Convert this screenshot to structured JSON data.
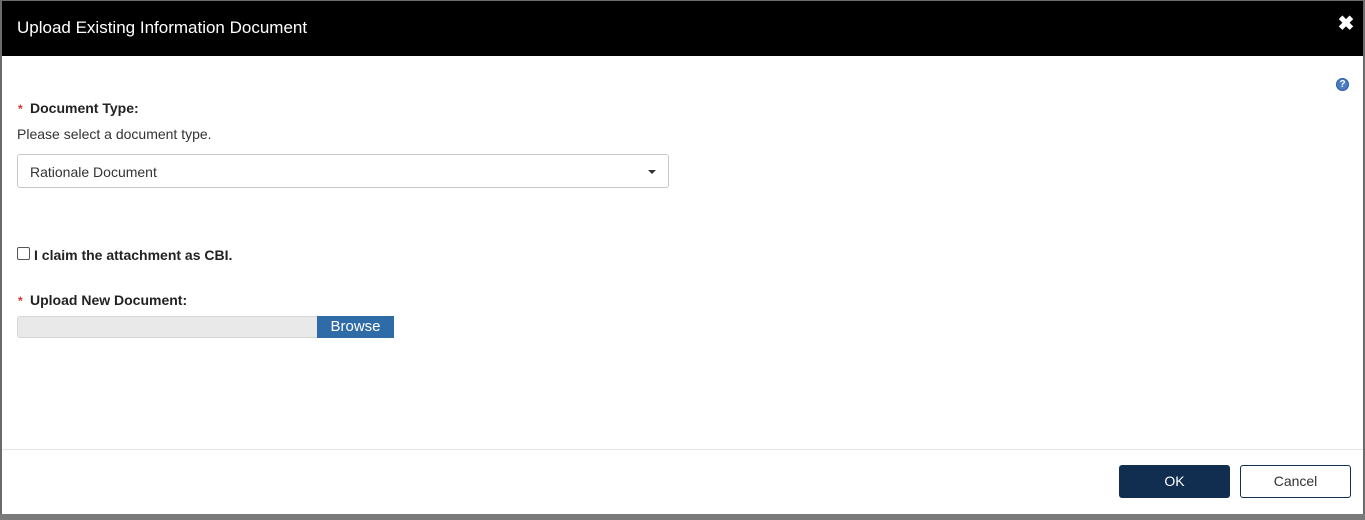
{
  "dialog": {
    "title": "Upload Existing Information Document",
    "close_icon": "close-icon",
    "help_icon": "help-icon"
  },
  "document_type": {
    "required_marker": "*",
    "label": "Document Type:",
    "hint": "Please select a document type.",
    "selected": "Rationale Document"
  },
  "cbi": {
    "checked": false,
    "label": "I claim the attachment as CBI."
  },
  "upload": {
    "required_marker": "*",
    "label": "Upload New Document:",
    "browse_label": "Browse"
  },
  "footer": {
    "ok_label": "OK",
    "cancel_label": "Cancel"
  },
  "colors": {
    "header_bg": "#000000",
    "primary_button": "#112e51",
    "browse_button": "#2f6ba7",
    "required_star": "#d9302c"
  }
}
